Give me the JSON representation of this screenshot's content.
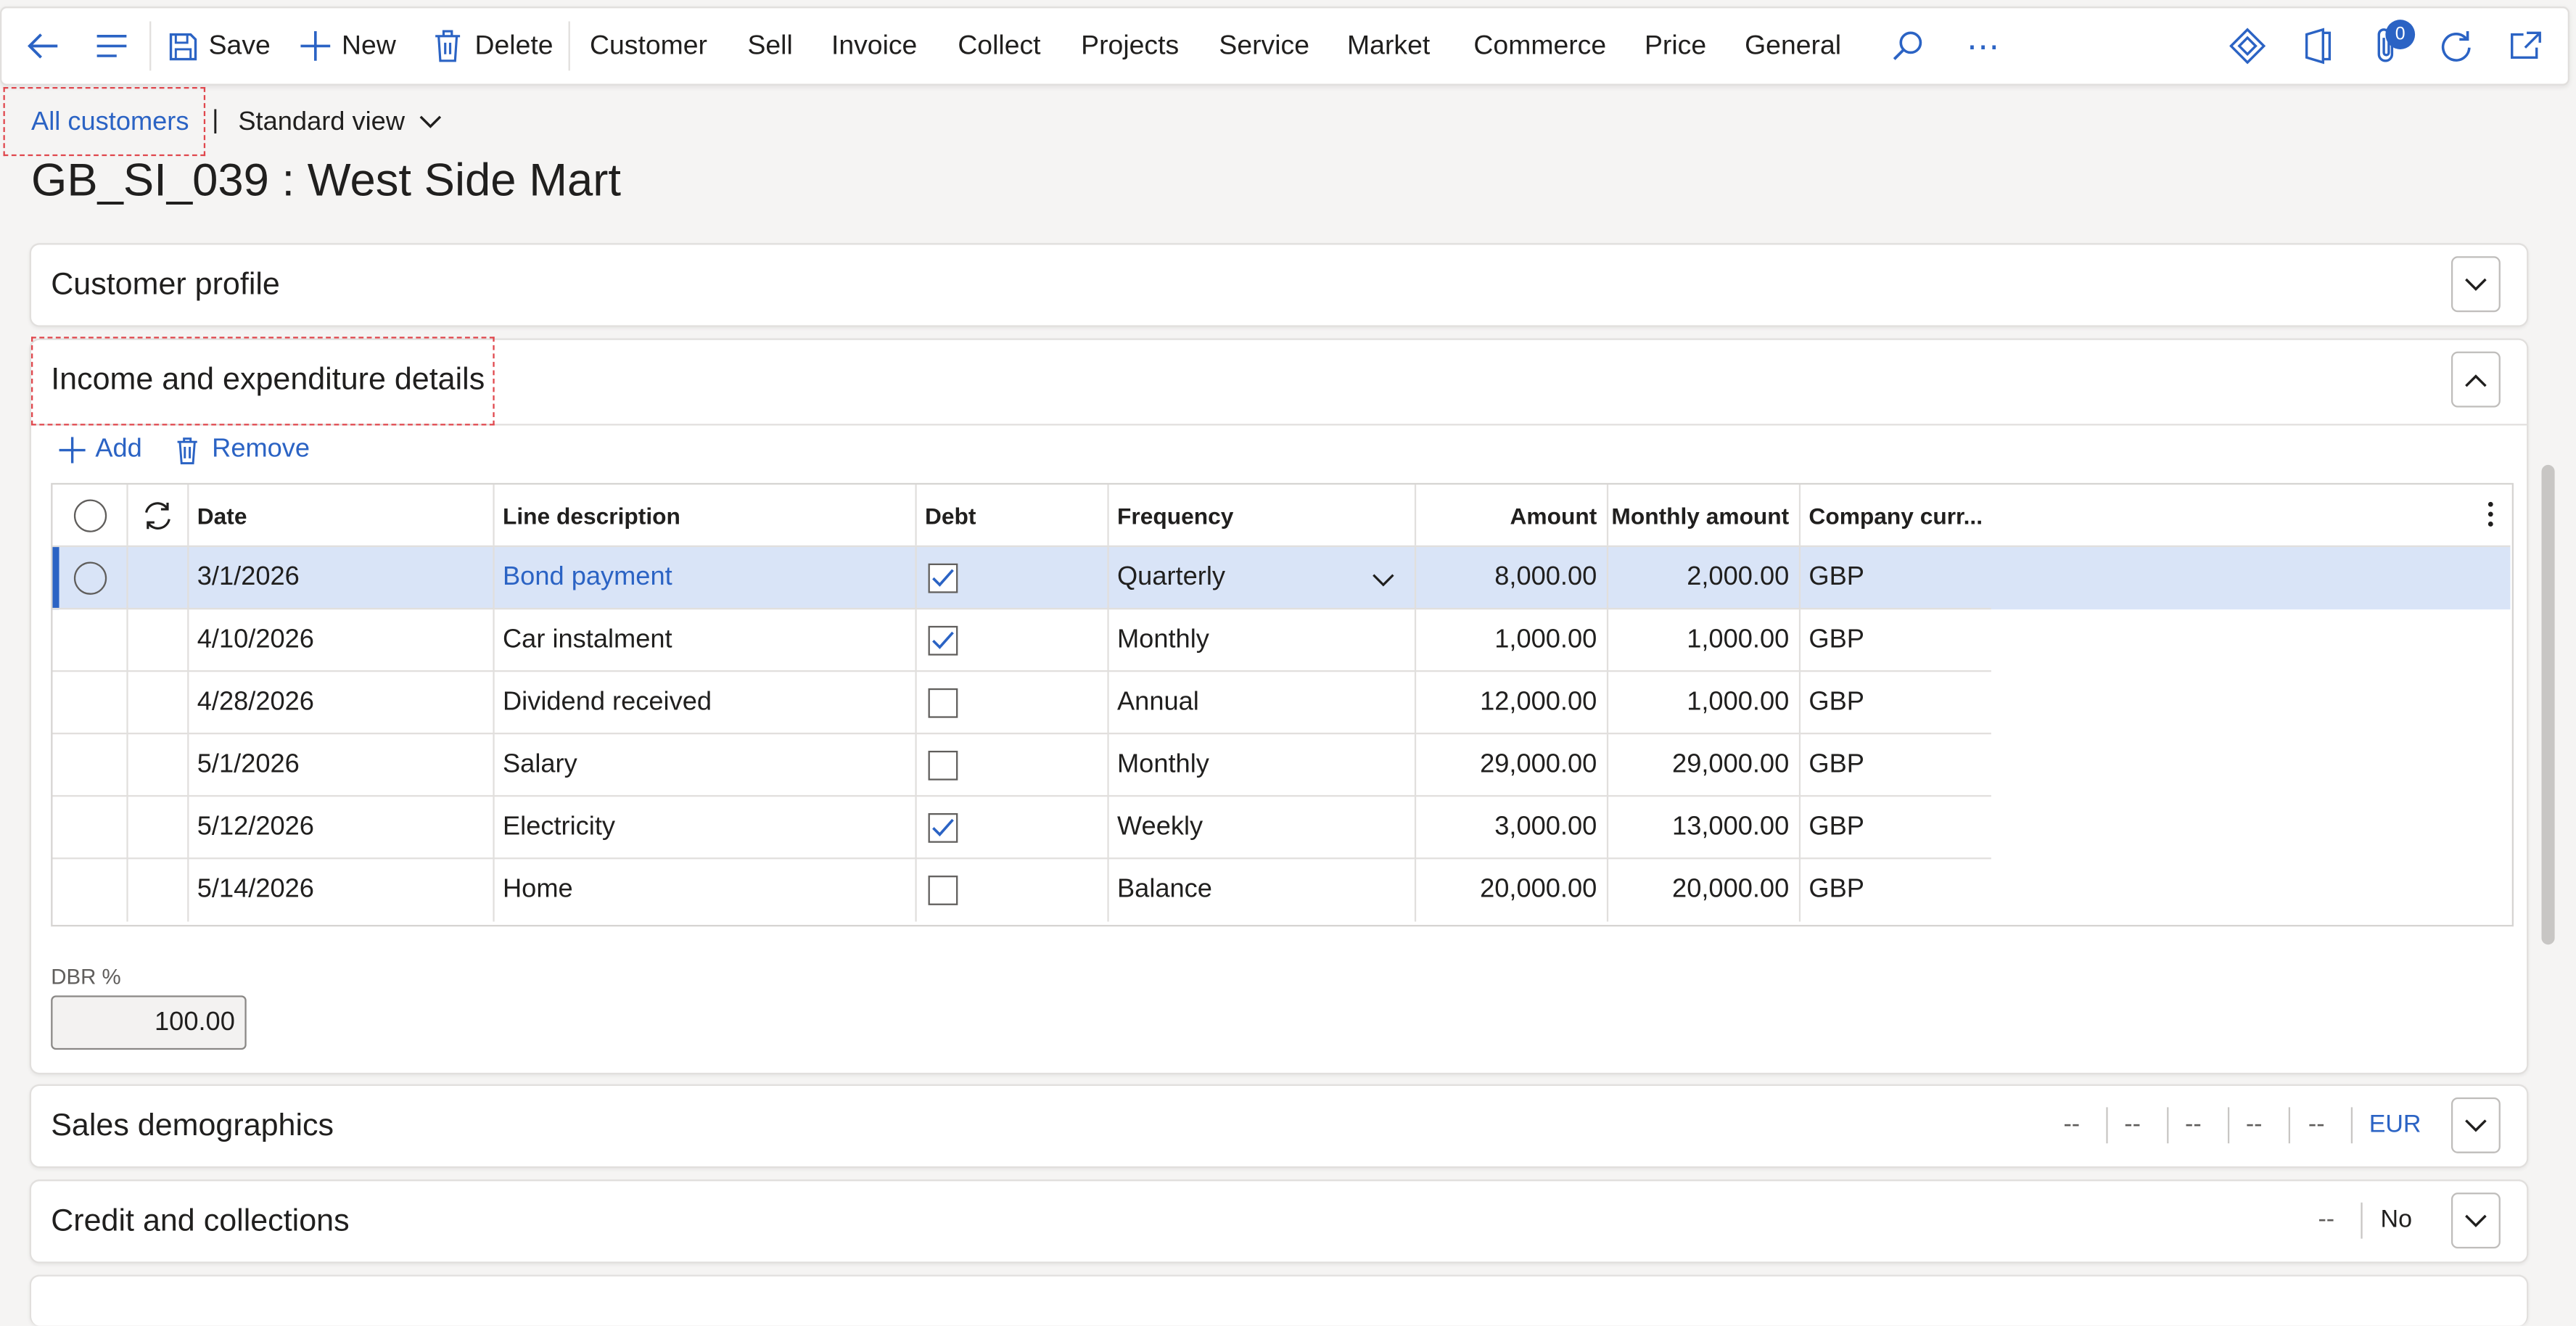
{
  "toolbar": {
    "save_label": "Save",
    "new_label": "New",
    "delete_label": "Delete",
    "menus": [
      "Customer",
      "Sell",
      "Invoice",
      "Collect",
      "Projects",
      "Service",
      "Market",
      "Commerce",
      "Price",
      "General"
    ],
    "ellipsis": "⋯",
    "notification_count": "0"
  },
  "breadcrumb": {
    "link": "All customers",
    "separator": "|",
    "view": "Standard view"
  },
  "page_title": "GB_SI_039 : West Side Mart",
  "sections": {
    "customer_profile": "Customer profile",
    "income": "Income and expenditure details",
    "sales": "Sales demographics",
    "credit": "Credit and collections"
  },
  "grid_actions": {
    "add": "Add",
    "remove": "Remove"
  },
  "grid": {
    "headers": {
      "date": "Date",
      "description": "Line description",
      "debt": "Debt",
      "frequency": "Frequency",
      "amount": "Amount",
      "monthly": "Monthly amount",
      "currency": "Company curr..."
    },
    "rows": [
      {
        "date": "3/1/2026",
        "description": "Bond payment",
        "debt": true,
        "frequency": "Quarterly",
        "amount": "8,000.00",
        "monthly": "2,000.00",
        "currency": "GBP"
      },
      {
        "date": "4/10/2026",
        "description": "Car instalment",
        "debt": true,
        "frequency": "Monthly",
        "amount": "1,000.00",
        "monthly": "1,000.00",
        "currency": "GBP"
      },
      {
        "date": "4/28/2026",
        "description": "Dividend received",
        "debt": false,
        "frequency": "Annual",
        "amount": "12,000.00",
        "monthly": "1,000.00",
        "currency": "GBP"
      },
      {
        "date": "5/1/2026",
        "description": "Salary",
        "debt": false,
        "frequency": "Monthly",
        "amount": "29,000.00",
        "monthly": "29,000.00",
        "currency": "GBP"
      },
      {
        "date": "5/12/2026",
        "description": "Electricity",
        "debt": true,
        "frequency": "Weekly",
        "amount": "3,000.00",
        "monthly": "13,000.00",
        "currency": "GBP"
      },
      {
        "date": "5/14/2026",
        "description": "Home",
        "debt": false,
        "frequency": "Balance",
        "amount": "20,000.00",
        "monthly": "20,000.00",
        "currency": "GBP"
      }
    ]
  },
  "dbr": {
    "label": "DBR %",
    "value": "100.00"
  },
  "sales_summary": {
    "values": [
      "--",
      "--",
      "--",
      "--",
      "--"
    ],
    "currency": "EUR"
  },
  "credit_summary": {
    "value": "--",
    "flag": "No"
  },
  "colors": {
    "accent": "#2b63c4",
    "selected_row": "#d9e4f7",
    "highlight_box": "#e0464c"
  }
}
